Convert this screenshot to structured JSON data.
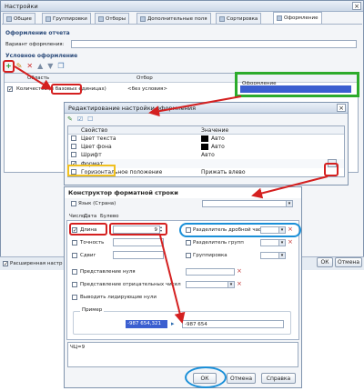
{
  "main": {
    "title": "Настройки",
    "tabs": [
      "Общие",
      "Группировки",
      "Отборы",
      "Дополнительные поля",
      "Сортировка",
      "Оформление"
    ],
    "section": "Оформление отчета",
    "variant_label": "Вариант оформления:",
    "cond_label": "Условное оформление",
    "col_area": "Область",
    "col_filter": "Отбор",
    "col_design": "Оформление",
    "row1_area": "Количество (в базовых единицах)",
    "row1_filter": "<без условия>",
    "ext_label": "Расширенная настр",
    "ok": "ОК",
    "cancel": "Отмена"
  },
  "editor": {
    "title": "Редактирование настройки оформления",
    "col_prop": "Свойство",
    "col_val": "Значение",
    "rows": [
      {
        "prop": "Цвет текста",
        "val": "Авто",
        "checked": false
      },
      {
        "prop": "Цвет фона",
        "val": "Авто",
        "checked": false
      },
      {
        "prop": "Шрифт",
        "val": "Авто",
        "checked": false
      },
      {
        "prop": "Формат",
        "val": "",
        "checked": true
      },
      {
        "prop": "Горизонтальное положение",
        "val": "Прижать влево",
        "checked": false
      }
    ],
    "ellipsis": "..."
  },
  "fmt": {
    "title": "Конструктор форматной строки",
    "lang_label": "Язык (Страна)",
    "tabs": [
      "Число",
      "Дата",
      "Булево"
    ],
    "length_label": "Длина",
    "length_value": "9",
    "precision_label": "Точность",
    "shift_label": "Сдвиг",
    "decimal_sep_label": "Разделитель дробной части",
    "group_sep_label": "Разделитель групп",
    "grouping_label": "Группировка",
    "null_label": "Представление нуля",
    "neg_label": "Представление отрицательных чисел",
    "leading_zeros_label": "Выводить лидирующие нули",
    "example_label": "Пример",
    "example_source": "-987 654,321",
    "example_result": "-987 654",
    "format_string": "ЧЦ=9",
    "ok": "ОК",
    "cancel": "Отмена",
    "help": "Справка"
  },
  "colors": {
    "accent_red": "#d42020",
    "accent_green": "#2cab2c",
    "accent_yellow": "#f0c020",
    "accent_blue": "#1a8fd8",
    "selected_bar": "#3b5fd0"
  }
}
